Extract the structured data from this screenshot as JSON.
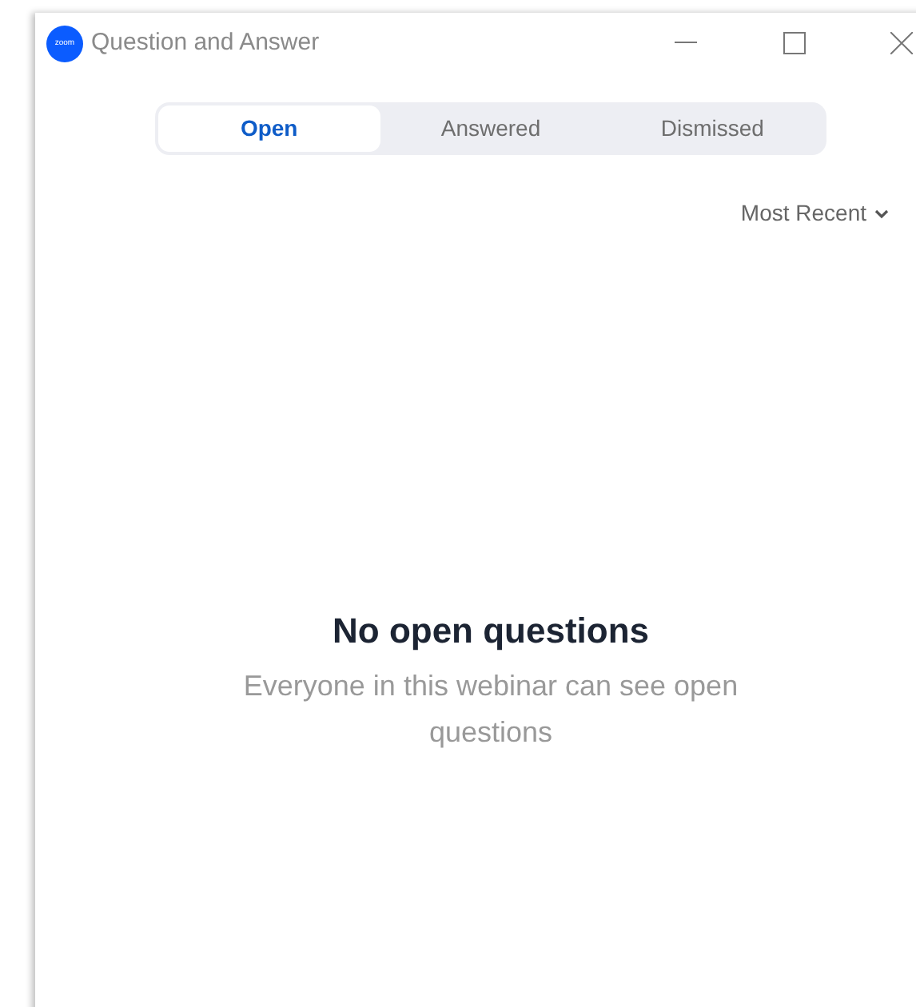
{
  "window": {
    "logo_text": "zoom",
    "title": "Question and Answer"
  },
  "tabs": [
    {
      "label": "Open",
      "selected": true
    },
    {
      "label": "Answered",
      "selected": false
    },
    {
      "label": "Dismissed",
      "selected": false
    }
  ],
  "sort": {
    "label": "Most Recent"
  },
  "empty_state": {
    "heading": "No open questions",
    "message": "Everyone in this webinar can see open questions"
  }
}
